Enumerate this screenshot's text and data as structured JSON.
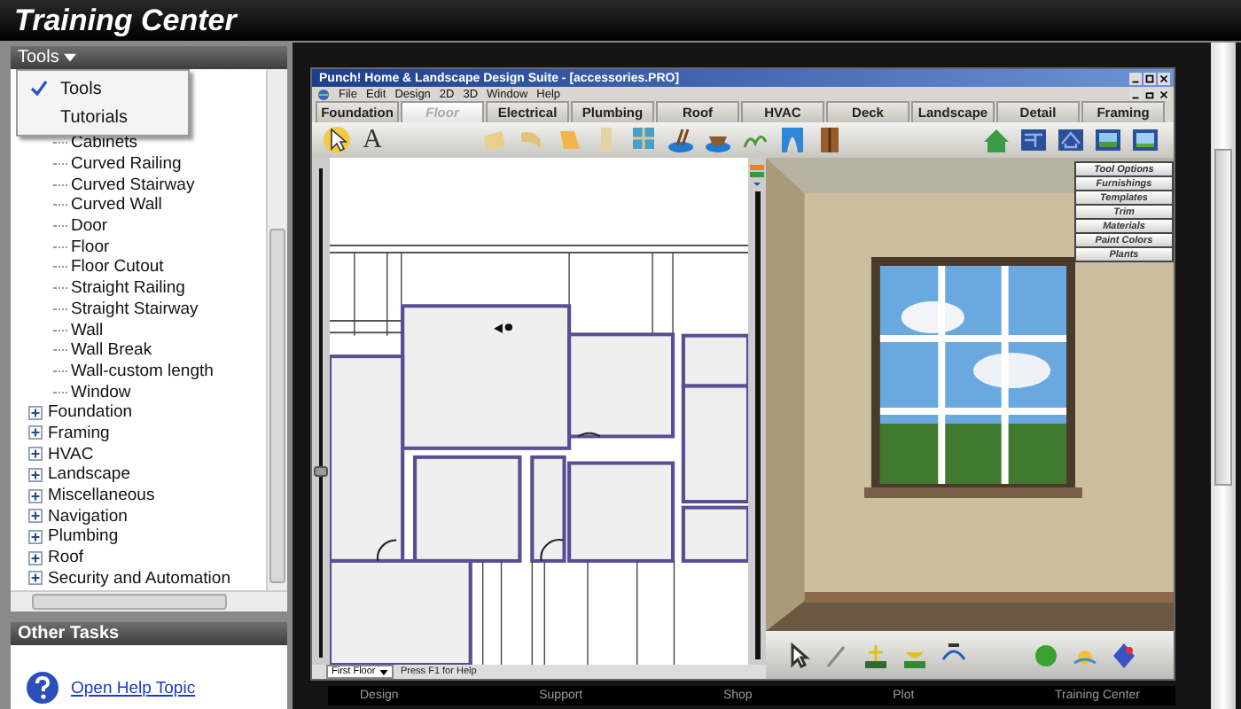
{
  "header": {
    "title": "Training Center"
  },
  "tools_panel": {
    "dropdown_label": "Tools",
    "menu": [
      {
        "label": "Tools",
        "selected": true
      },
      {
        "label": "Tutorials",
        "selected": false
      }
    ],
    "tree": [
      {
        "children": [
          {
            "label": "Cabinets"
          },
          {
            "label": "Curved Railing"
          },
          {
            "label": "Curved Stairway"
          },
          {
            "label": "Curved Wall"
          },
          {
            "label": "Door"
          },
          {
            "label": "Floor"
          },
          {
            "label": "Floor Cutout"
          },
          {
            "label": "Straight Railing"
          },
          {
            "label": "Straight Stairway"
          },
          {
            "label": "Wall"
          },
          {
            "label": "Wall Break"
          },
          {
            "label": "Wall-custom length"
          },
          {
            "label": "Window"
          }
        ]
      },
      {
        "label": "Foundation",
        "expanded": false
      },
      {
        "label": "Framing",
        "expanded": false
      },
      {
        "label": "HVAC",
        "expanded": false
      },
      {
        "label": "Landscape",
        "expanded": false
      },
      {
        "label": "Miscellaneous",
        "expanded": false
      },
      {
        "label": "Navigation",
        "expanded": false
      },
      {
        "label": "Plumbing",
        "expanded": false
      },
      {
        "label": "Roof",
        "expanded": false
      },
      {
        "label": "Security and Automation",
        "expanded": false
      }
    ]
  },
  "other_tasks": {
    "title": "Other Tasks",
    "links": [
      "Open Help Topic"
    ]
  },
  "app_window": {
    "title": "Punch! Home & Landscape Design Suite - [accessories.PRO]",
    "menu": [
      "File",
      "Edit",
      "Design",
      "2D",
      "3D",
      "Window",
      "Help"
    ],
    "tabs": [
      {
        "label": "Foundation",
        "selected": false
      },
      {
        "label": "Floor",
        "selected": true
      },
      {
        "label": "Electrical",
        "selected": false
      },
      {
        "label": "Plumbing",
        "selected": false
      },
      {
        "label": "Roof",
        "selected": false
      },
      {
        "label": "HVAC",
        "selected": false
      },
      {
        "label": "Deck",
        "selected": false
      },
      {
        "label": "Landscape",
        "selected": false
      },
      {
        "label": "Detail",
        "selected": false
      },
      {
        "label": "Framing",
        "selected": false
      }
    ],
    "text_tool": "A",
    "zoom_slider": {
      "level": 0.37
    },
    "side_menu": [
      "Tool Options",
      "Furnishings",
      "Templates",
      "Trim",
      "Materials",
      "Paint Colors",
      "Plants"
    ],
    "floor_select": "First Floor",
    "status_hint": "Press F1 for Help"
  },
  "bottom_nav": [
    "Design",
    "Support",
    "Shop",
    "Plot",
    "Training Center"
  ]
}
